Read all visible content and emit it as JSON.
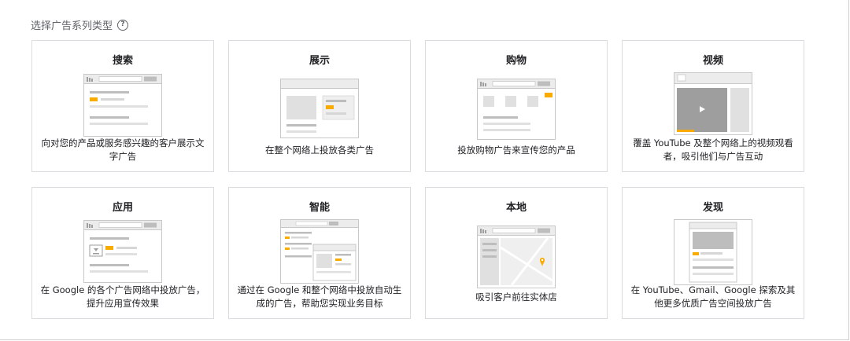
{
  "heading": "选择广告系列类型",
  "colors": {
    "accent": "#f9ab00",
    "mock_bar": "#bdbdbd",
    "mock_panel": "#e8e8e8",
    "mock_border": "#c8c8c8",
    "video": "#9e9e9e",
    "map_pin": "#f9ab00"
  },
  "cards": [
    {
      "title": "搜索",
      "desc": "向对您的产品或服务感兴趣的客户展示文字广告",
      "icon": "search-ad-illustration-icon"
    },
    {
      "title": "展示",
      "desc": "在整个网络上投放各类广告",
      "icon": "display-ad-illustration-icon"
    },
    {
      "title": "购物",
      "desc": "投放购物广告来宣传您的产品",
      "icon": "shopping-ad-illustration-icon"
    },
    {
      "title": "视频",
      "desc": "覆盖 YouTube 及整个网络上的视频观看者，吸引他们与广告互动",
      "icon": "video-ad-illustration-icon"
    },
    {
      "title": "应用",
      "desc": "在 Google 的各个广告网络中投放广告，提升应用宣传效果",
      "icon": "app-ad-illustration-icon"
    },
    {
      "title": "智能",
      "desc": "通过在 Google 和整个网络中投放自动生成的广告，帮助您实现业务目标",
      "icon": "smart-ad-illustration-icon"
    },
    {
      "title": "本地",
      "desc": "吸引客户前往实体店",
      "icon": "local-ad-illustration-icon"
    },
    {
      "title": "发现",
      "desc": "在 YouTube、Gmail、Google 探索及其他更多优质广告空间投放广告",
      "icon": "discovery-ad-illustration-icon"
    }
  ]
}
